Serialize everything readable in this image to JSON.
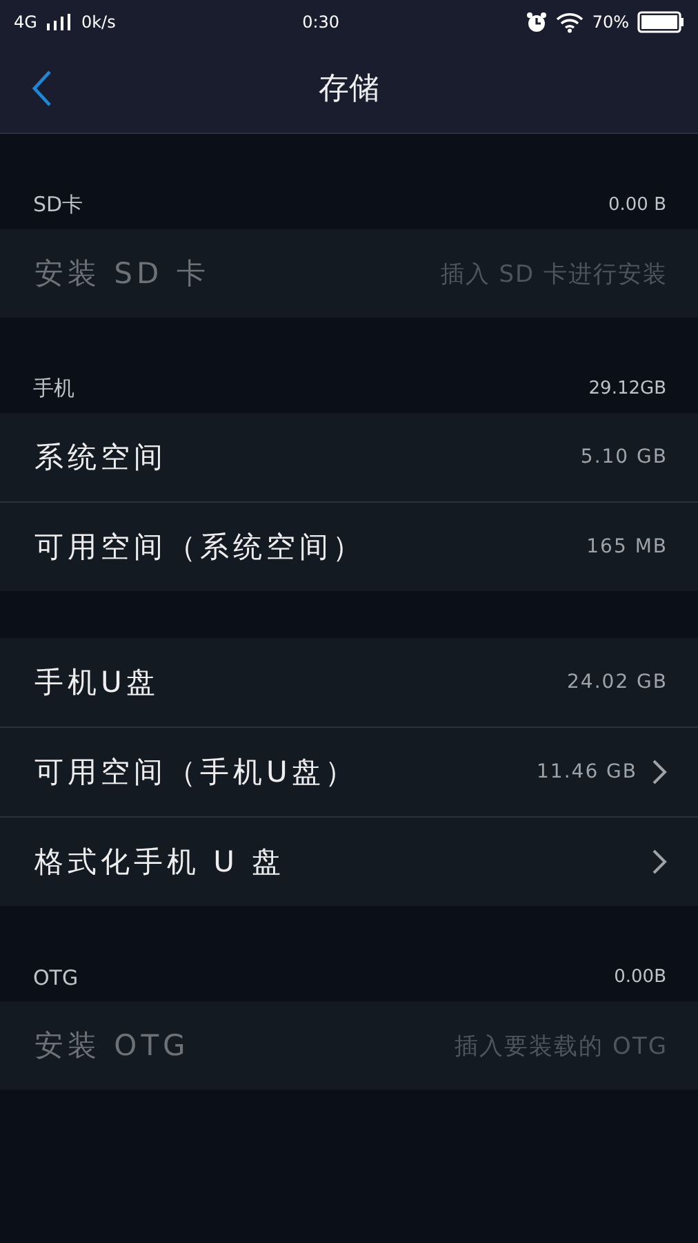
{
  "status_bar": {
    "network": "4G",
    "speed": "0k/s",
    "time": "0:30",
    "battery": "70%"
  },
  "header": {
    "title": "存储"
  },
  "sections": [
    {
      "header": {
        "label": "SD卡",
        "value": "0.00 B"
      },
      "rows": [
        {
          "label": "安装 SD 卡",
          "value": "插入 SD 卡进行安装",
          "disabled": true,
          "chevron": false
        }
      ]
    },
    {
      "header": {
        "label": "手机",
        "value": "29.12GB"
      },
      "rows": [
        {
          "label": "系统空间",
          "value": "5.10 GB",
          "disabled": false,
          "chevron": false
        },
        {
          "label": "可用空间（系统空间）",
          "value": "165 MB",
          "disabled": false,
          "chevron": false
        }
      ]
    },
    {
      "rows": [
        {
          "label": "手机U盘",
          "value": "24.02 GB",
          "disabled": false,
          "chevron": false
        },
        {
          "label": "可用空间（手机U盘）",
          "value": "11.46 GB",
          "disabled": false,
          "chevron": true
        },
        {
          "label": "格式化手机 U 盘",
          "disabled": false,
          "chevron": true
        }
      ]
    },
    {
      "header": {
        "label": "OTG",
        "value": "0.00B"
      },
      "rows": [
        {
          "label": "安装 OTG",
          "value": "插入要装载的 OTG",
          "disabled": true,
          "chevron": false
        }
      ]
    }
  ]
}
